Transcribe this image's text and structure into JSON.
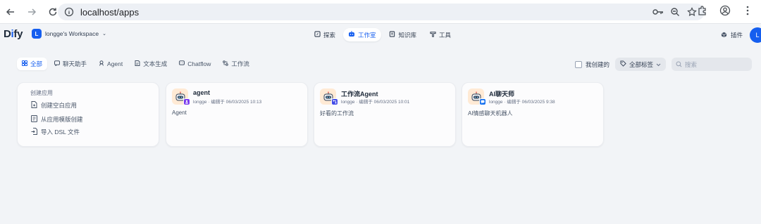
{
  "browser": {
    "url": "localhost/apps"
  },
  "header": {
    "logo": "Dify",
    "workspace_initial": "L",
    "workspace_name": "longge's Workspace",
    "nav": [
      {
        "label": "探索",
        "icon": "compass-icon"
      },
      {
        "label": "工作室",
        "icon": "robot-icon"
      },
      {
        "label": "知识库",
        "icon": "book-icon"
      },
      {
        "label": "工具",
        "icon": "hammer-icon"
      }
    ],
    "plugins_label": "插件",
    "user_initial": "L"
  },
  "filters": {
    "tabs": [
      {
        "label": "全部",
        "icon": "grid-icon"
      },
      {
        "label": "聊天助手",
        "icon": "chat-icon"
      },
      {
        "label": "Agent",
        "icon": "agent-icon"
      },
      {
        "label": "文本生成",
        "icon": "document-icon"
      },
      {
        "label": "Chatflow",
        "icon": "chatflow-icon"
      },
      {
        "label": "工作流",
        "icon": "workflow-icon"
      }
    ],
    "active_tab": "全部",
    "created_by_me_label": "我创建的",
    "tag_filter_label": "全部标签",
    "search_placeholder": "搜索"
  },
  "create_card": {
    "title": "创建应用",
    "items": [
      {
        "label": "创建空白应用",
        "icon": "file-plus-icon"
      },
      {
        "label": "从应用模版创建",
        "icon": "template-icon"
      },
      {
        "label": "导入 DSL 文件",
        "icon": "import-icon"
      }
    ]
  },
  "apps": [
    {
      "name": "agent",
      "author": "longge",
      "edited": "编辑于 06/03/2025 10:13",
      "description": "Agent",
      "badge_color": "#7839ee",
      "icon": "robot-icon",
      "badge_icon": "agent-badge-icon"
    },
    {
      "name": "工作流Agent",
      "author": "longge",
      "edited": "编辑于 06/03/2025 10:01",
      "description": "好看的工作流",
      "badge_color": "#444ce7",
      "icon": "robot-icon",
      "badge_icon": "workflow-badge-icon"
    },
    {
      "name": "AI聊天师",
      "author": "longge",
      "edited": "编辑于 06/03/2025 9:38",
      "description": "AI情感聊天机器人",
      "badge_color": "#1570ef",
      "icon": "robot-icon",
      "badge_icon": "chat-badge-icon"
    }
  ],
  "colors": {
    "accent": "#155eef",
    "background": "#f2f4f7"
  }
}
